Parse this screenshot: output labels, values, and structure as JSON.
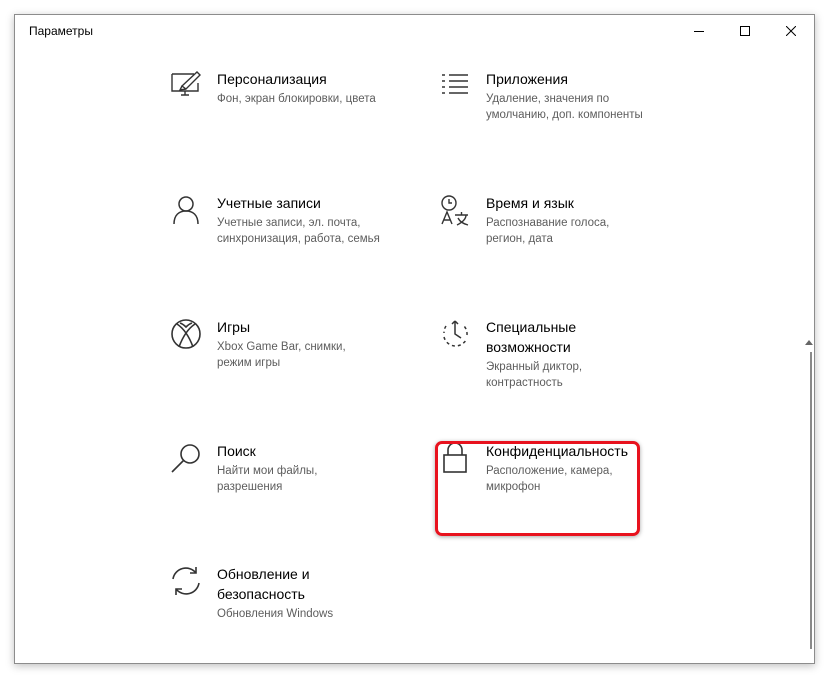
{
  "window": {
    "title": "Параметры",
    "controls": [
      "minimize",
      "maximize",
      "close"
    ]
  },
  "items": [
    {
      "icon": "personalization-icon",
      "name": "Персонализация",
      "desc": [
        "Фон, экран блокировки, цвета"
      ]
    },
    {
      "icon": "apps-icon",
      "name": "Приложения",
      "desc": [
        "Удаление, значения по",
        "умолчанию, доп. компоненты"
      ]
    },
    {
      "icon": "user-icon",
      "name": "Учетные записи",
      "desc": [
        "Учетные записи, эл. почта,",
        "синхронизация, работа, семья"
      ]
    },
    {
      "icon": "time-language-icon",
      "name": "Время и язык",
      "desc": [
        "Распознавание голоса,",
        "регион, дата"
      ]
    },
    {
      "icon": "xbox-icon",
      "name": "Игры",
      "desc": [
        "Xbox Game Bar, снимки,",
        "режим игры"
      ]
    },
    {
      "icon": "accessibility-icon",
      "name": [
        "Специальные",
        "возможности"
      ],
      "desc": [
        "Экранный диктор,",
        "контрастность"
      ]
    },
    {
      "icon": "search-icon",
      "name": "Поиск",
      "desc": [
        "Найти мои файлы,",
        "разрешения"
      ]
    },
    {
      "icon": "lock-icon",
      "name": "Конфиденциальность",
      "desc": [
        "Расположение, камера,",
        "микрофон"
      ]
    },
    {
      "icon": "sync-icon",
      "name": [
        "Обновление и",
        "безопасность"
      ],
      "desc": [
        "Обновления Windows"
      ]
    }
  ],
  "highlight_color": "#e8121e"
}
